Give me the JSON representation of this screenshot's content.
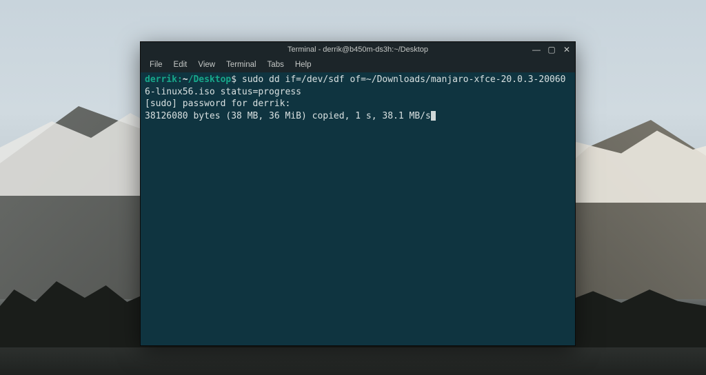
{
  "window": {
    "title": "Terminal - derrik@b450m-ds3h:~/Desktop"
  },
  "menubar": {
    "items": [
      "File",
      "Edit",
      "View",
      "Terminal",
      "Tabs",
      "Help"
    ]
  },
  "terminal": {
    "prompt_user": "derrik",
    "prompt_sep": ":",
    "prompt_tilde": "~",
    "prompt_path": "/Desktop",
    "prompt_end": "$ ",
    "command": "sudo dd if=/dev/sdf of=~/Downloads/manjaro-xfce-20.0.3-200606-linux56.iso status=progress",
    "sudo_prompt": "[sudo] password for derrik:",
    "progress_line": "38126080 bytes (38 MB, 36 MiB) copied, 1 s, 38.1 MB/s"
  }
}
